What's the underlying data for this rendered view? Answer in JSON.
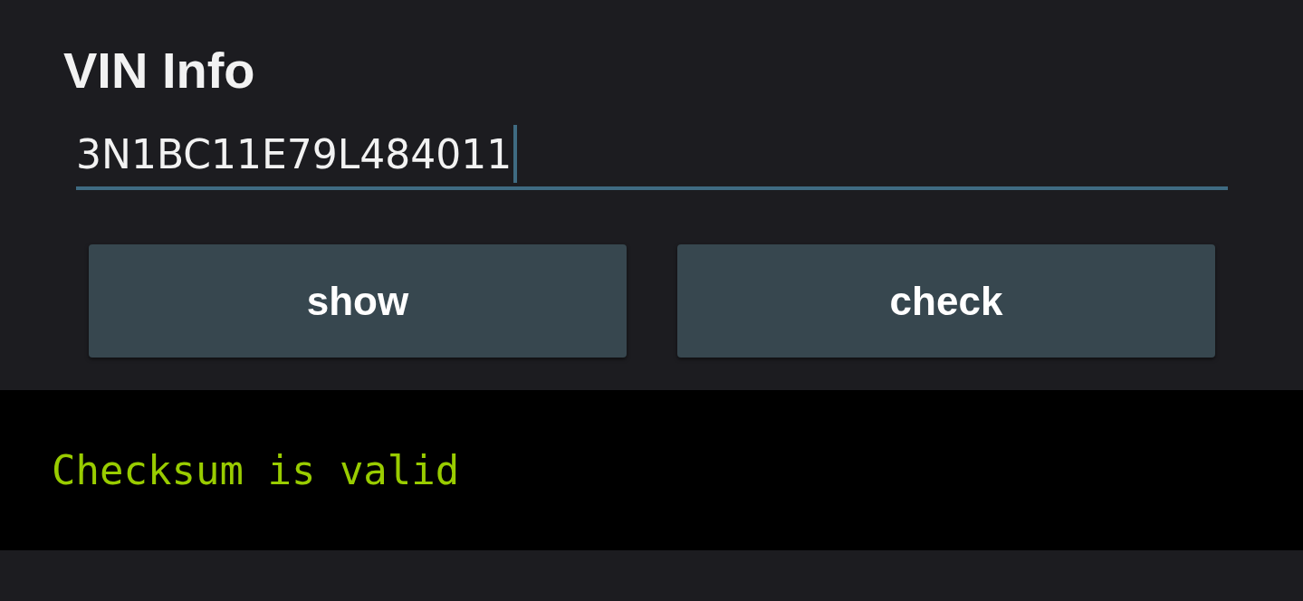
{
  "title": "VIN Info",
  "vin_field": {
    "value": "3N1BC11E79L484011",
    "focused": true
  },
  "buttons": [
    {
      "label": "show"
    },
    {
      "label": "check"
    }
  ],
  "output": {
    "text": "Checksum is valid"
  }
}
